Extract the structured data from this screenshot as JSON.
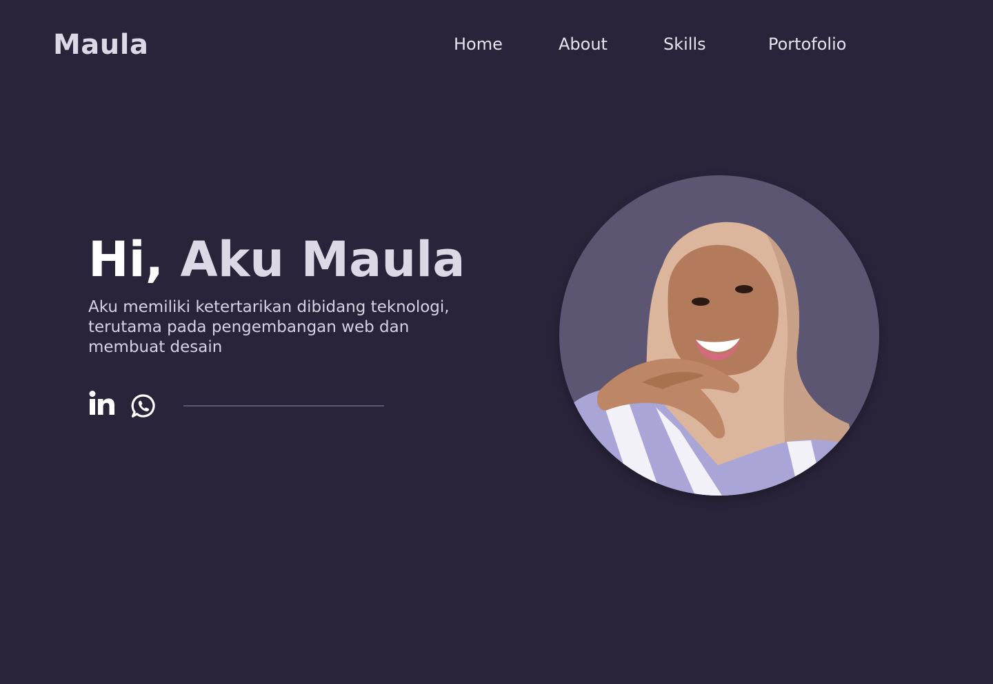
{
  "brand": {
    "logo_text": "Maula"
  },
  "nav": {
    "items": [
      {
        "label": "Home"
      },
      {
        "label": "About"
      },
      {
        "label": "Skills"
      },
      {
        "label": "Portofolio"
      }
    ]
  },
  "hero": {
    "greeting": "Hi,",
    "name": "Aku Maula",
    "description": "Aku memiliki ketertarikan dibidang teknologi, terutama pada pengembangan web dan membuat desain"
  },
  "socials": [
    {
      "icon": "linkedin-icon"
    },
    {
      "icon": "whatsapp-icon"
    }
  ],
  "colors": {
    "background": "#29243a",
    "accent_text": "#dcd8e6",
    "avatar_bg": "#5c5672"
  }
}
